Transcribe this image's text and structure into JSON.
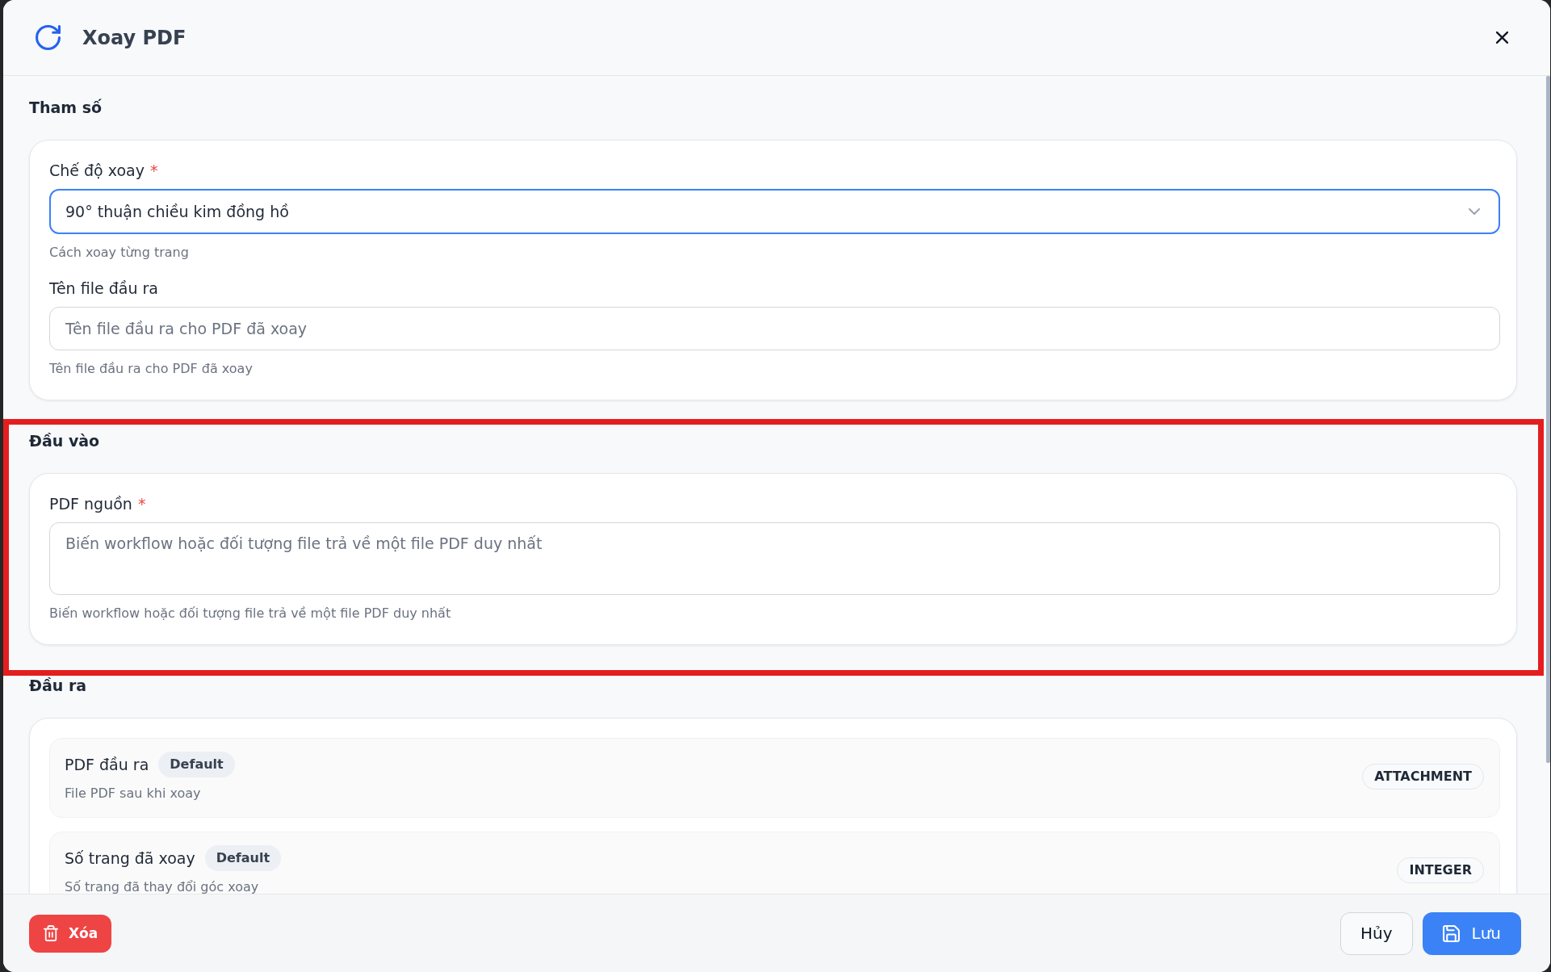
{
  "dialog": {
    "title": "Xoay PDF"
  },
  "sections": [
    {
      "title": "Tham số",
      "highlighted": false,
      "fields": [
        {
          "kind": "select",
          "label": "Chế độ xoay",
          "required_mark": "*",
          "value": "90° thuận chiều kim đồng hồ",
          "focused": true,
          "help": "Cách xoay từng trang"
        },
        {
          "kind": "text",
          "label": "Tên file đầu ra",
          "placeholder": "Tên file đầu ra cho PDF đã xoay",
          "focused": false,
          "help": "Tên file đầu ra cho PDF đã xoay"
        }
      ]
    },
    {
      "title": "Đầu vào",
      "highlighted": true,
      "fields": [
        {
          "kind": "textarea",
          "label": "PDF nguồn",
          "required_mark": "*",
          "placeholder": "Biến workflow hoặc đối tượng file trả về một file PDF duy nhất",
          "focused": false,
          "help": "Biến workflow hoặc đối tượng file trả về một file PDF duy nhất"
        }
      ]
    },
    {
      "title": "Đầu ra",
      "highlighted": false,
      "outputs": [
        {
          "name": "PDF đầu ra",
          "badge": "Default",
          "description": "File PDF sau khi xoay",
          "type": "ATTACHMENT"
        },
        {
          "name": "Số trang đã xoay",
          "badge": "Default",
          "description": "Số trang đã thay đổi góc xoay",
          "type": "INTEGER"
        }
      ]
    }
  ],
  "footer": {
    "delete_label": "Xóa",
    "cancel_label": "Hủy",
    "save_label": "Lưu"
  }
}
